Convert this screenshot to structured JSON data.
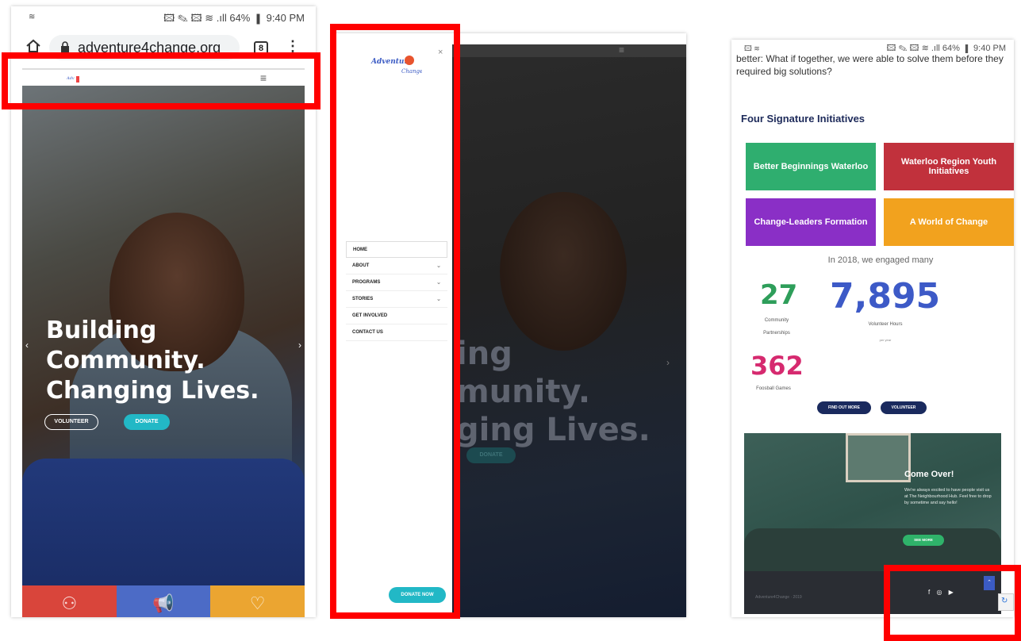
{
  "colors": {
    "highlight": "#ff0000",
    "teal": "#22b8c6",
    "navy": "#1a2a5e",
    "green_stat": "#2e9e5a",
    "blue_stat": "#3d5ac7",
    "pink_stat": "#d62a6f"
  },
  "phone_status": {
    "left": "≋",
    "right": "🖾 ✎ 🖾 ≋ .ıll 64% ▮ 9:40 PM"
  },
  "browser": {
    "url": "adventure4change.org",
    "tab_count": "8",
    "home_icon": "home-icon",
    "lock_icon": "lock-icon",
    "menu_icon": "kebab-menu-icon"
  },
  "hero": {
    "title_lines": [
      "Building",
      "Community.",
      "Changing Lives."
    ],
    "volunteer_label": "VOLUNTEER",
    "donate_label": "DONATE",
    "prev_arrow": "‹",
    "next_arrow": "›",
    "tile_icons": [
      "people-icon",
      "megaphone-icon",
      "heart-hand-icon"
    ],
    "tile_colors": [
      "#d9453b",
      "#4c6bc6",
      "#eba531"
    ]
  },
  "drawer": {
    "close": "×",
    "menu": [
      {
        "label": "HOME",
        "has_submenu": false
      },
      {
        "label": "ABOUT",
        "has_submenu": true
      },
      {
        "label": "PROGRAMS",
        "has_submenu": true
      },
      {
        "label": "STORIES",
        "has_submenu": true
      },
      {
        "label": "GET INVOLVED",
        "has_submenu": false
      },
      {
        "label": "CONTACT US",
        "has_submenu": false
      }
    ],
    "donate_now": "DONATE NOW",
    "dim_hero_lines": [
      "ing",
      "munity.",
      "ging Lives."
    ],
    "dim_donate": "DONATE"
  },
  "homepage": {
    "status_left": "🖾 ≋",
    "status_right": "🖾 ✎ 🖾 ≋ .ıll 64% ▮ 9:40 PM",
    "intro_lines": [
      "better: What if together, we were able to solve them before they",
      "required big solutions?"
    ],
    "initiatives_title": "Four Signature Initiatives",
    "initiatives": [
      {
        "label": "Better Beginnings Waterloo",
        "color": "#2fae6f"
      },
      {
        "label": "Waterloo Region Youth Initiatives",
        "color": "#c1313c"
      },
      {
        "label": "Change-Leaders Formation",
        "color": "#8a2fc6"
      },
      {
        "label": "A World of Change",
        "color": "#f2a21e"
      }
    ],
    "engaged_text": "In 2018, we engaged many",
    "stats": [
      {
        "value": "27",
        "label_lines": [
          "Community",
          "Partnerships"
        ]
      },
      {
        "value": "7,895",
        "label_lines": [
          "Volunteer Hours"
        ],
        "sub": "per year"
      },
      {
        "value": "362",
        "label_lines": [
          "Foosball Games"
        ]
      }
    ],
    "find_out_more": "FIND OUT MORE",
    "volunteer": "VOLUNTEER",
    "come_over": {
      "title": "Come Over!",
      "text": "We're always excited to have people visit us at The Neighbourhood Hub. Feel free to drop by sometime and say hello!",
      "button": "SEE MORE"
    },
    "footer_copyright": "Adventure4Change · 2019",
    "social": "f ◎ ▶",
    "back_to_top": "⌃"
  }
}
